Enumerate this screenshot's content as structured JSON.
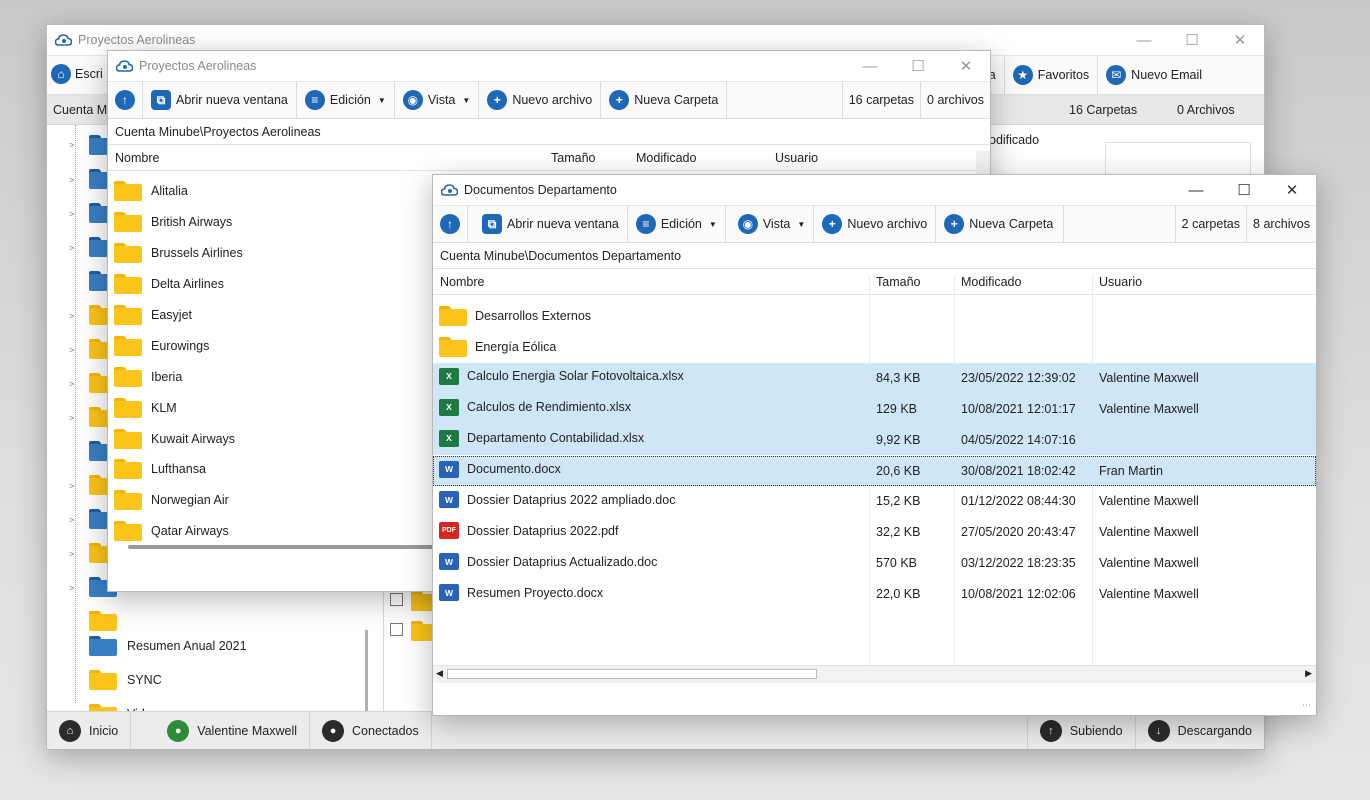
{
  "back_window": {
    "title": "Proyectos Aerolineas",
    "toolbar_left": "Escri",
    "toolbar_right": [
      {
        "label": "queda",
        "icon": "search-icon"
      },
      {
        "label": "Favoritos",
        "icon": "star-icon"
      },
      {
        "label": "Nuevo Email",
        "icon": "email-icon"
      }
    ],
    "path_partial": "Cuenta M",
    "col_partial": "odificado",
    "counts": {
      "folders": "16 Carpetas",
      "files": "0 Archivos"
    },
    "tree_items": [
      "Resumen Anual 2021",
      "SYNC",
      "Videos"
    ],
    "status": {
      "home": "Inicio",
      "user": "Valentine Maxwell",
      "connected": "Conectados",
      "uploading": "Subiendo",
      "downloading": "Descargando"
    }
  },
  "middle_window": {
    "title": "Proyectos Aerolineas",
    "toolbar": {
      "open_new": "Abrir nueva ventana",
      "edit": "Edición",
      "view": "Vista",
      "new_file": "Nuevo archivo",
      "new_folder": "Nueva Carpeta"
    },
    "counts": {
      "folders": "16 carpetas",
      "files": "0 archivos"
    },
    "path": "Cuenta Minube\\Proyectos Aerolineas",
    "columns": {
      "name": "Nombre",
      "size": "Tamaño",
      "modified": "Modificado",
      "user": "Usuario"
    },
    "folders": [
      "Alitalia",
      "British Airways",
      "Brussels Airlines",
      "Delta Airlines",
      "Easyjet",
      "Eurowings",
      "Iberia",
      "KLM",
      "Kuwait Airways",
      "Lufthansa",
      "Norwegian Air",
      "Qatar Airways"
    ]
  },
  "front_window": {
    "title": "Documentos Departamento",
    "toolbar": {
      "open_new": "Abrir nueva ventana",
      "edit": "Edición",
      "view": "Vista",
      "new_file": "Nuevo archivo",
      "new_folder": "Nueva Carpeta"
    },
    "counts": {
      "folders": "2 carpetas",
      "files": "8 archivos"
    },
    "path": "Cuenta Minube\\Documentos Departamento",
    "columns": {
      "name": "Nombre",
      "size": "Tamaño",
      "modified": "Modificado",
      "user": "Usuario"
    },
    "rows": [
      {
        "name": "Desarrollos Externos",
        "size": "",
        "modified": "",
        "user": "",
        "type": "folder",
        "selected": false
      },
      {
        "name": "Energía Eólica",
        "size": "",
        "modified": "",
        "user": "",
        "type": "folder",
        "selected": false
      },
      {
        "name": "Calculo Energia Solar Fotovoltaica.xlsx",
        "size": "84,3 KB",
        "modified": "23/05/2022 12:39:02",
        "user": "Valentine Maxwell",
        "type": "excel",
        "selected": true
      },
      {
        "name": "Calculos de Rendimiento.xlsx",
        "size": "129 KB",
        "modified": "10/08/2021 12:01:17",
        "user": "Valentine Maxwell",
        "type": "excel",
        "selected": true
      },
      {
        "name": "Departamento Contabilidad.xlsx",
        "size": "9,92 KB",
        "modified": "04/05/2022 14:07:16",
        "user": "",
        "type": "excel",
        "selected": true
      },
      {
        "name": "Documento.docx",
        "size": "20,6 KB",
        "modified": "30/08/2021 18:02:42",
        "user": "Fran Martin",
        "type": "word",
        "selected": true,
        "focused": true
      },
      {
        "name": "Dossier Dataprius 2022 ampliado.doc",
        "size": "15,2 KB",
        "modified": "01/12/2022 08:44:30",
        "user": "Valentine Maxwell",
        "type": "word",
        "selected": false
      },
      {
        "name": "Dossier Dataprius 2022.pdf",
        "size": "32,2 KB",
        "modified": "27/05/2020 20:43:47",
        "user": "Valentine Maxwell",
        "type": "pdf",
        "selected": false
      },
      {
        "name": "Dossier Dataprius Actualizado.doc",
        "size": "570 KB",
        "modified": "03/12/2022 18:23:35",
        "user": "Valentine Maxwell",
        "type": "word",
        "selected": false
      },
      {
        "name": "Resumen Proyecto.docx",
        "size": "22,0 KB",
        "modified": "10/08/2021 12:02:06",
        "user": "Valentine Maxwell",
        "type": "word",
        "selected": false
      }
    ]
  },
  "colors": {
    "accent": "#1e68b5",
    "selection": "#cfe6f7",
    "folder": "#fcc419"
  }
}
